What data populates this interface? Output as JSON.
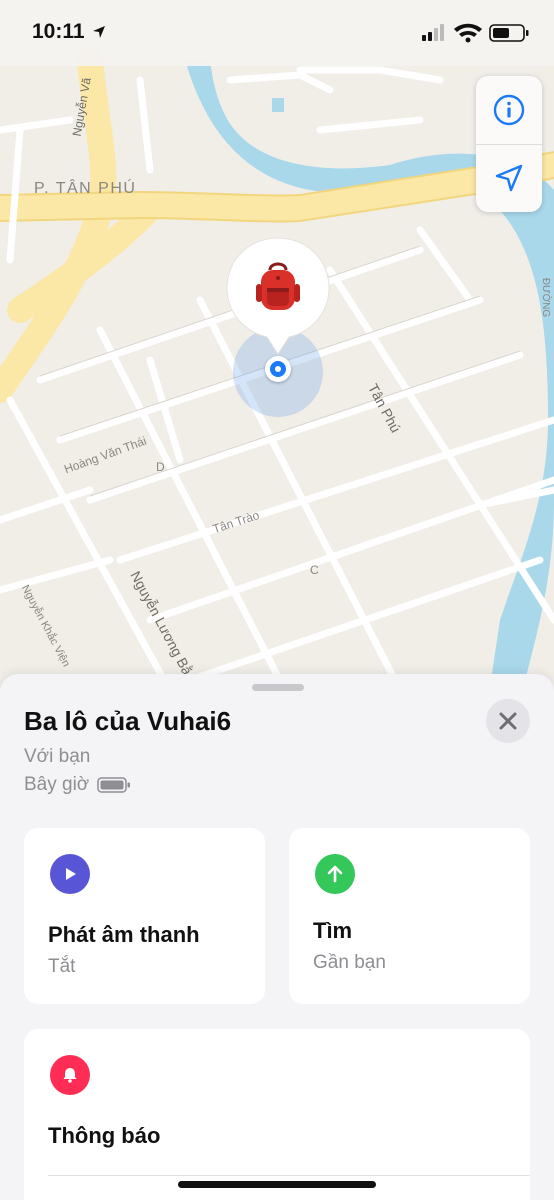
{
  "status_bar": {
    "time": "10:11"
  },
  "map": {
    "labels": {
      "district": "P. TÂN PHÚ",
      "street_tan_phu": "Tân Phú",
      "street_hoang_van_thai": "Hoàng Văn Thái",
      "street_tan_trao": "Tân Trào",
      "street_nguyen_luong_bang": "Nguyễn Lương Bằ",
      "street_nguyen_khac_vien": "Nguyễn Khắc Viện",
      "street_nguyen_van": "Nguyễn Vă",
      "street_d": "D",
      "street_c": "C",
      "street_duong": "ĐƯỜNG"
    },
    "colors": {
      "water": "#a8d8ea",
      "major_road": "#fbe7a6",
      "blue_dot": "#1a7af8"
    },
    "pin_item": "backpack"
  },
  "item": {
    "name": "Ba lô của Vuhai6",
    "status": "Với bạn",
    "updated": "Bây giờ"
  },
  "actions": {
    "play_sound": {
      "title": "Phát âm thanh",
      "subtitle": "Tắt",
      "color": "#5856d6"
    },
    "find": {
      "title": "Tìm",
      "subtitle": "Gần bạn",
      "color": "#34c759"
    },
    "notifications": {
      "title": "Thông báo",
      "color": "#ff2d55"
    }
  }
}
